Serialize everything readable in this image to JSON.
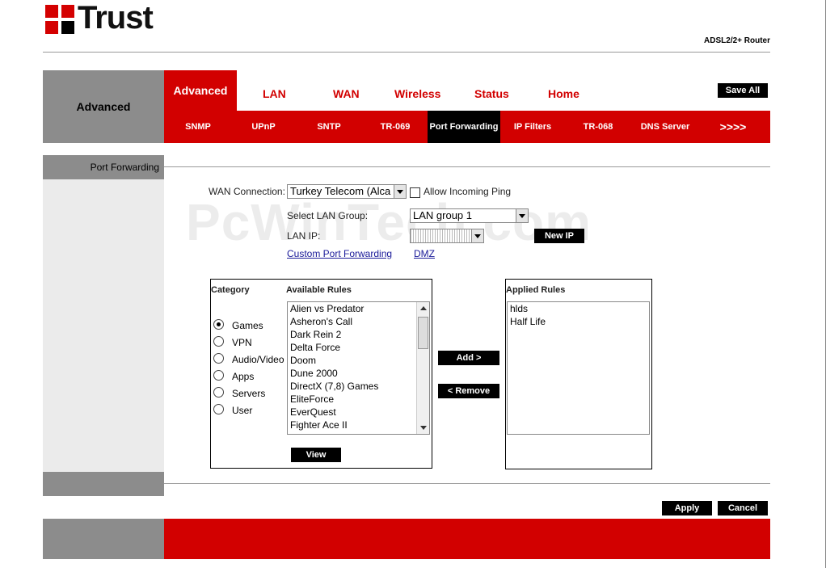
{
  "header": {
    "brand": "Trust",
    "model": "ADSL2/2+ Router"
  },
  "nav": {
    "section_title": "Advanced",
    "main_tabs": [
      {
        "label": "Advanced"
      },
      {
        "label": "LAN"
      },
      {
        "label": "WAN"
      },
      {
        "label": "Wireless"
      },
      {
        "label": "Status"
      },
      {
        "label": "Home"
      }
    ],
    "save_all": "Save All",
    "sub_tabs": [
      {
        "label": "SNMP"
      },
      {
        "label": "UPnP"
      },
      {
        "label": "SNTP"
      },
      {
        "label": "TR-069"
      },
      {
        "label": "Port Forwarding"
      },
      {
        "label": "IP Filters"
      },
      {
        "label": "TR-068"
      },
      {
        "label": "DNS Server"
      },
      {
        "label": ">>>>"
      }
    ]
  },
  "page": {
    "section_label": "Port Forwarding",
    "watermark": "PcWinTech.com"
  },
  "form": {
    "wan_connection_label": "WAN Connection:",
    "wan_connection_value": "Turkey Telecom (Alca",
    "allow_ping_label": "Allow Incoming Ping",
    "lan_group_label": "Select LAN Group:",
    "lan_group_value": "LAN group 1",
    "lan_ip_label": "LAN IP:",
    "new_ip_button": "New IP",
    "custom_pf_link": "Custom Port Forwarding",
    "dmz_link": "DMZ"
  },
  "rules": {
    "category_header": "Category",
    "available_header": "Available Rules",
    "applied_header": "Applied Rules",
    "categories": [
      {
        "label": "Games",
        "checked": true
      },
      {
        "label": "VPN",
        "checked": false
      },
      {
        "label": "Audio/Video",
        "checked": false
      },
      {
        "label": "Apps",
        "checked": false
      },
      {
        "label": "Servers",
        "checked": false
      },
      {
        "label": "User",
        "checked": false
      }
    ],
    "available": [
      "Alien vs Predator",
      "Asheron's Call",
      "Dark Rein 2",
      "Delta Force",
      "Doom",
      "Dune 2000",
      "DirectX (7,8) Games",
      "EliteForce",
      "EverQuest",
      "Fighter Ace II"
    ],
    "applied": [
      "hlds",
      "Half Life"
    ],
    "add_button": "Add >",
    "remove_button": "< Remove",
    "view_button": "View"
  },
  "footer": {
    "apply": "Apply",
    "cancel": "Cancel"
  }
}
